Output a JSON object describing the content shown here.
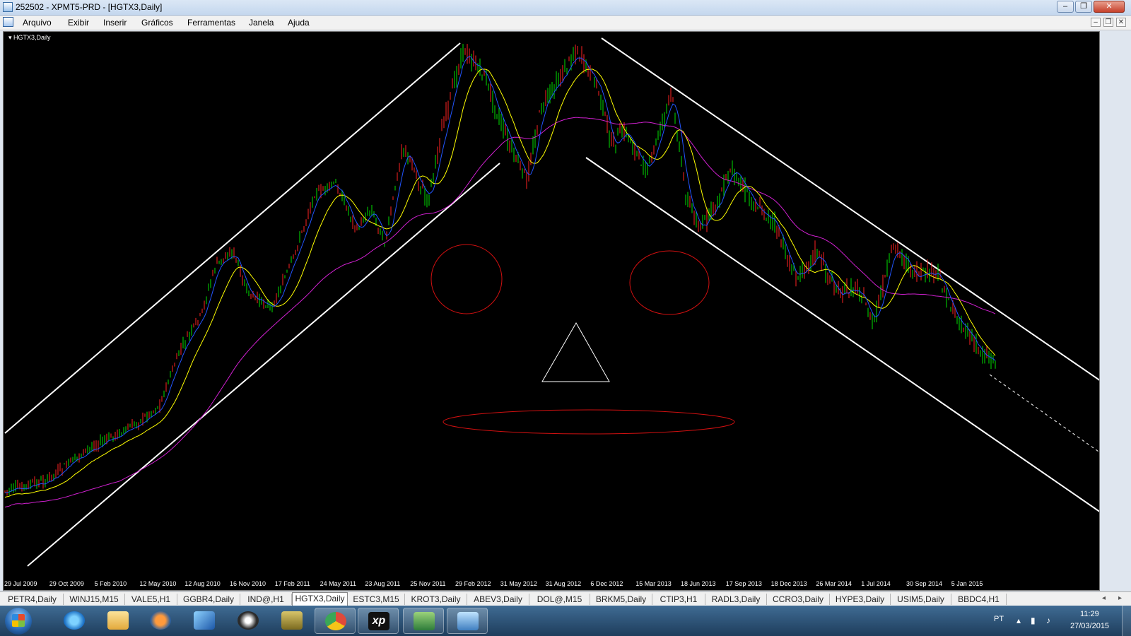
{
  "window": {
    "title": "252502 - XPMT5-PRD - [HGTX3,Daily]"
  },
  "menu": [
    "Arquivo",
    "Exibir",
    "Inserir",
    "Gráficos",
    "Ferramentas",
    "Janela",
    "Ajuda"
  ],
  "window_controls": {
    "minimize": "–",
    "maximize": "❐",
    "close": "✕"
  },
  "mdi_controls": {
    "minimize": "–",
    "restore": "❐",
    "close": "✕"
  },
  "chart": {
    "symbol_label": "HGTX3,Daily",
    "dates": [
      "29 Jul 2009",
      "29 Oct 2009",
      "5 Feb 2010",
      "12 May 2010",
      "12 Aug 2010",
      "16 Nov 2010",
      "17 Feb 2011",
      "24 May 2011",
      "23 Aug 2011",
      "25 Nov 2011",
      "29 Feb 2012",
      "31 May 2012",
      "31 Aug 2012",
      "6 Dec 2012",
      "15 Mar 2013",
      "18 Jun 2013",
      "17 Sep 2013",
      "18 Dec 2013",
      "26 Mar 2014",
      "1 Jul 2014",
      "30 Sep 2014",
      "5 Jan 2015"
    ],
    "colors": {
      "background": "#000000",
      "bull": "#00e000",
      "bear": "#ff2222",
      "ma_fast": "#0044ff",
      "ma_mid": "#ffff00",
      "ma_slow": "#d020d0",
      "channel": "#ffffff",
      "drawing": "#d01010"
    }
  },
  "tabs": [
    "PETR4,Daily",
    "WINJ15,M15",
    "VALE5,H1",
    "GGBR4,Daily",
    "IND@,H1",
    "HGTX3,Daily",
    "ESTC3,M15",
    "KROT3,Daily",
    "ABEV3,Daily",
    "DOL@,M15",
    "BRKM5,Daily",
    "CTIP3,H1",
    "RADL3,Daily",
    "CCRO3,Daily",
    "HYPE3,Daily",
    "USIM5,Daily",
    "BBDC4,H1"
  ],
  "active_tab": "HGTX3,Daily",
  "tab_nav": {
    "left": "◂",
    "right": "▸"
  },
  "taskbar": {
    "items": [
      "start",
      "internet-explorer",
      "file-explorer",
      "media-player",
      "cube",
      "hp",
      "folder-tools",
      "chrome",
      "xp",
      "metatrader",
      "image-viewer"
    ],
    "lang": "PT",
    "time": "11:29",
    "date": "27/03/2015"
  }
}
